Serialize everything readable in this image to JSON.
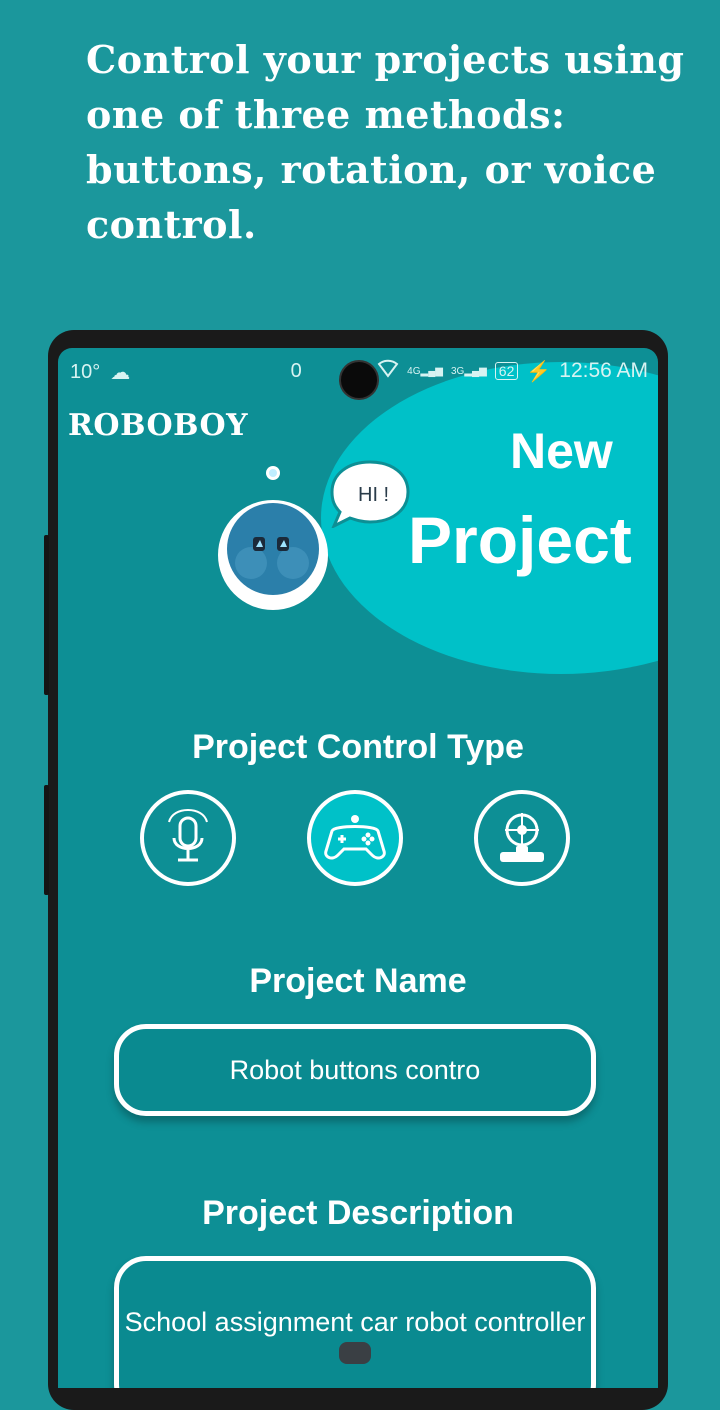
{
  "headline": "Control your projects using one of three methods: buttons, rotation, or voice control.",
  "status_bar": {
    "temp": "10°",
    "network_4g": "4G",
    "network_3g": "3G",
    "battery": "62",
    "time": "12:56 AM",
    "partial_text": "0"
  },
  "app": {
    "logo": "ROBOBOY",
    "title_line1": "New",
    "title_line2": "Project",
    "bubble": "HI !"
  },
  "form": {
    "control_type_label": "Project Control Type",
    "control_types": [
      "voice-control",
      "buttons-control",
      "rotation-control"
    ],
    "selected_control": "buttons-control",
    "name_label": "Project Name",
    "name_value": "Robot buttons contro",
    "description_label": "Project Description",
    "description_value": "School assignment car robot controller"
  },
  "colors": {
    "background": "#1b979c",
    "screen": "#0d8f95",
    "accent": "#00c1c8",
    "text": "#ffffff"
  }
}
